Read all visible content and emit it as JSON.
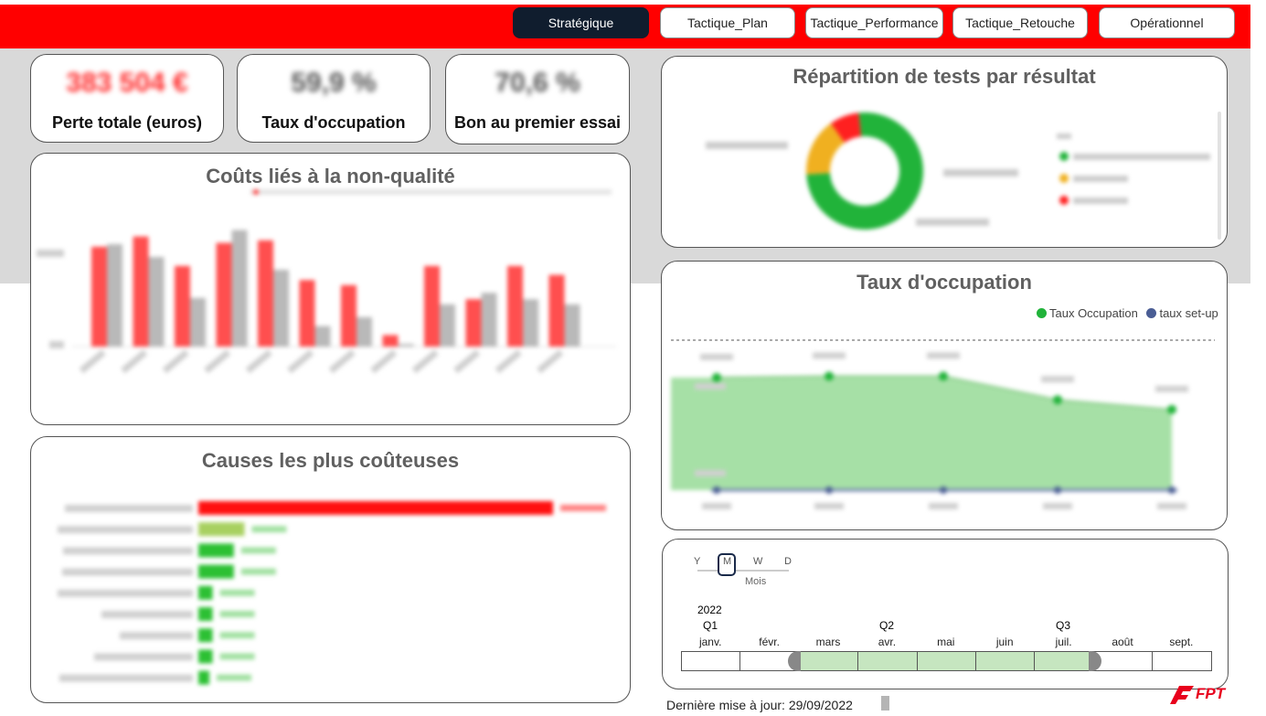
{
  "nav": {
    "tabs": [
      {
        "label": "Stratégique",
        "active": true
      },
      {
        "label": "Tactique_Plan",
        "active": false
      },
      {
        "label": "Tactique_Performance",
        "active": false
      },
      {
        "label": "Tactique_Retouche",
        "active": false
      },
      {
        "label": "Opérationnel",
        "active": false
      }
    ]
  },
  "kpis": [
    {
      "value": "383 504 €",
      "label": "Perte totale (euros)",
      "color": "#ff2a2a"
    },
    {
      "value": "59,9 %",
      "label": "Taux d'occupation",
      "color": "#555555"
    },
    {
      "value": "70,6 %",
      "label": "Bon au premier essai",
      "color": "#555555"
    }
  ],
  "panels": {
    "non_quality": {
      "title": "Coûts liés à la non-qualité"
    },
    "causes": {
      "title": "Causes les plus coûteuses"
    },
    "tests": {
      "title": "Répartition de tests par résultat"
    },
    "occupation": {
      "title": "Taux d'occupation",
      "legend": [
        "Taux Occupation",
        "taux set-up"
      ]
    }
  },
  "colors": {
    "red": "#ff0000",
    "grey_bar": "#b9b9b9",
    "green": "#21b33a",
    "orange": "#f0b020",
    "navy": "#101d2e",
    "setup": "#4a5d94",
    "area": "#a6e0a6"
  },
  "slicer": {
    "granularity": [
      "Y",
      "M",
      "W",
      "D"
    ],
    "selected_granularity": "M",
    "granularity_label": "Mois",
    "year": "2022",
    "quarters": [
      "Q1",
      "Q2",
      "Q3"
    ],
    "months": [
      "janv.",
      "févr.",
      "mars",
      "avr.",
      "mai",
      "juin",
      "juil.",
      "août",
      "sept."
    ],
    "selected_months": [
      "mars",
      "avr.",
      "mai",
      "juin",
      "juil."
    ]
  },
  "footer": {
    "last_update": "Dernière mise à jour: 29/09/2022",
    "logo": "FPT"
  },
  "chart_data": [
    {
      "type": "bar",
      "title": "Coûts liés à la non-qualité",
      "series": [
        {
          "values": [
            0.78,
            0.86,
            0.63,
            0.81,
            0.83,
            0.52,
            0.48,
            0.09,
            0.63,
            0.37,
            0.63,
            0.56
          ]
        },
        {
          "values": [
            0.8,
            0.7,
            0.38,
            0.91,
            0.6,
            0.16,
            0.23,
            0.02,
            0.33,
            0.42,
            0.37,
            0.33
          ]
        }
      ]
    },
    {
      "type": "bar",
      "title": "Causes les plus coûteuses",
      "values": [
        100,
        13,
        10,
        10,
        4,
        4,
        4,
        4,
        3
      ]
    },
    {
      "type": "pie",
      "title": "Répartition de tests par résultat",
      "values": [
        75.7,
        16.1,
        8.2
      ]
    },
    {
      "type": "area",
      "title": "Taux d'occupation",
      "series": [
        {
          "name": "Taux Occupation",
          "values": [
            0.81,
            0.82,
            0.82,
            0.65,
            0.58
          ]
        },
        {
          "name": "taux set-up",
          "values": [
            0.0,
            0.0,
            0.0,
            0.0,
            0.0
          ]
        }
      ]
    }
  ]
}
